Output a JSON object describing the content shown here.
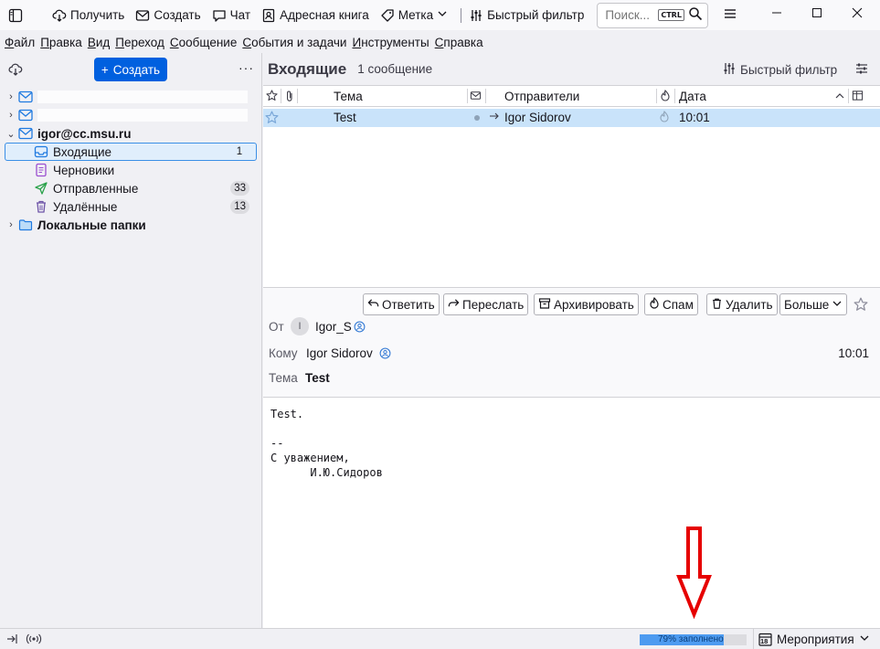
{
  "toolbar": {
    "get_mail": "Получить",
    "compose": "Создать",
    "chat": "Чат",
    "address_book": "Адресная книга",
    "tag": "Метка",
    "quick_filter": "Быстрый фильтр",
    "search_placeholder": "Поиск...",
    "search_shortcut": "CTRL"
  },
  "menu": [
    "Файл",
    "Правка",
    "Вид",
    "Переход",
    "Сообщение",
    "События и задачи",
    "Инструменты",
    "Справка"
  ],
  "folder_pane": {
    "create_button": "Создать",
    "account": "igor@cc.msu.ru",
    "folders": [
      {
        "label": "Входящие",
        "count": "1"
      },
      {
        "label": "Черновики",
        "count": ""
      },
      {
        "label": "Отправленные",
        "count": "33"
      },
      {
        "label": "Удалённые",
        "count": "13"
      }
    ],
    "local_folders": "Локальные папки"
  },
  "thread_pane": {
    "folder_title": "Входящие",
    "message_count": "1 сообщение",
    "quick_filter": "Быстрый фильтр",
    "columns": {
      "subject": "Тема",
      "correspondents": "Отправители",
      "date": "Дата"
    },
    "rows": [
      {
        "subject": "Test",
        "sender": "Igor Sidorov",
        "date": "10:01"
      }
    ]
  },
  "message": {
    "actions": {
      "reply": "Ответить",
      "forward": "Переслать",
      "archive": "Архивировать",
      "junk": "Спам",
      "delete": "Удалить",
      "more": "Больше"
    },
    "from_label": "От",
    "from_avatar": "I",
    "from_value": "Igor_S",
    "to_label": "Кому",
    "to_value": "Igor Sidorov",
    "date": "10:01",
    "subject_label": "Тема",
    "subject_value": "Test",
    "body": "Test.\n\n--\nС уважением,\n      И.Ю.Сидоров"
  },
  "status_bar": {
    "quota_text": "79% заполнено",
    "quota_percent": 79,
    "events": "Мероприятия",
    "calendar_day": "18"
  },
  "colors": {
    "accent": "#0060df",
    "selection": "#c9e3fa",
    "annotation_arrow": "#e60000"
  }
}
